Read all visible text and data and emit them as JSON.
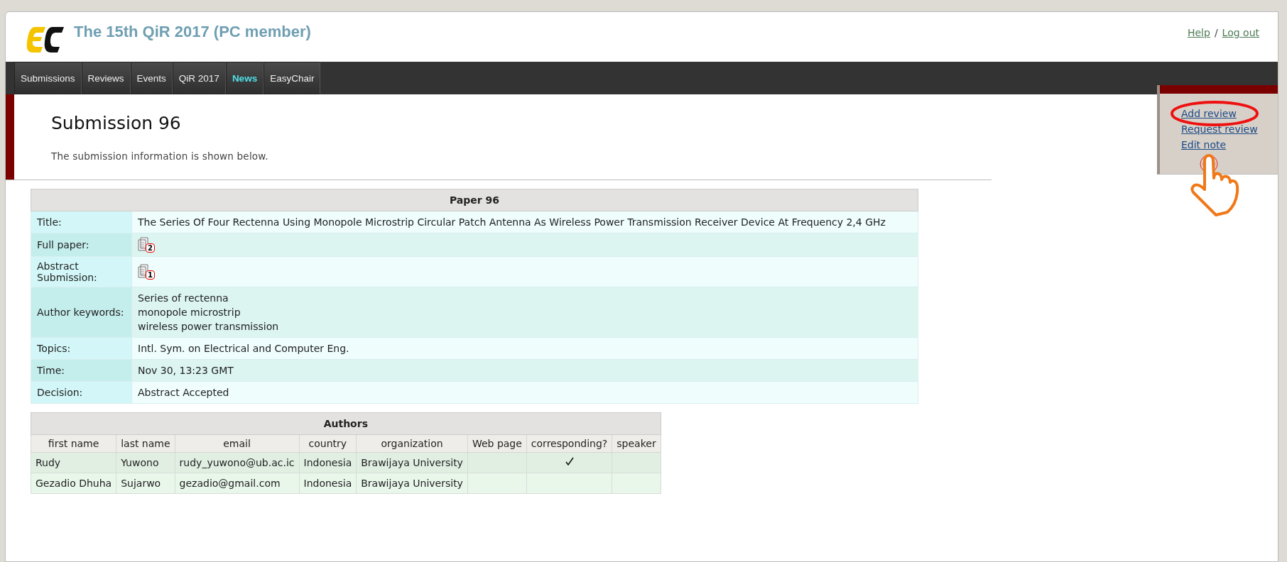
{
  "header": {
    "title": "The 15th QiR 2017 (PC member)",
    "links": [
      "Help",
      "Log out"
    ],
    "separator": "/"
  },
  "nav": [
    {
      "label": "Submissions",
      "highlighted": false
    },
    {
      "label": "Reviews",
      "highlighted": false
    },
    {
      "label": "Events",
      "highlighted": false
    },
    {
      "label": "QiR 2017",
      "highlighted": false
    },
    {
      "label": "News",
      "highlighted": true
    },
    {
      "label": "EasyChair",
      "highlighted": false
    }
  ],
  "page": {
    "heading": "Submission 96",
    "intro": "The submission information is shown below."
  },
  "side_menu": [
    "Add review",
    "Request review",
    "Edit note"
  ],
  "paper_table": {
    "caption": "Paper 96",
    "rows": [
      {
        "kind": "text",
        "label": "Title:",
        "value": "The Series Of Four Rectenna Using Monopole Microstrip Circular Patch Antenna As Wireless Power Transmission Receiver Device At Frequency 2,4 GHz"
      },
      {
        "kind": "file",
        "label": "Full paper:",
        "badge": "2"
      },
      {
        "kind": "file",
        "label": "Abstract Submission:",
        "badge": "1"
      },
      {
        "kind": "lines",
        "label": "Author keywords:",
        "lines": [
          "Series of rectenna",
          "monopole microstrip",
          "wireless power transmission"
        ]
      },
      {
        "kind": "text",
        "label": "Topics:",
        "value": "Intl. Sym. on Electrical and Computer Eng."
      },
      {
        "kind": "text",
        "label": "Time:",
        "value": "Nov 30, 13:23 GMT"
      },
      {
        "kind": "text",
        "label": "Decision:",
        "value": "Abstract Accepted"
      }
    ]
  },
  "authors_table": {
    "caption": "Authors",
    "columns": [
      "first name",
      "last name",
      "email",
      "country",
      "organization",
      "Web page",
      "corresponding?",
      "speaker"
    ],
    "rows": [
      {
        "first_name": "Rudy",
        "last_name": "Yuwono",
        "email": "rudy_yuwono@ub.ac.ic",
        "country": "Indonesia",
        "organization": "Brawijaya University",
        "corresponding": true
      },
      {
        "first_name": "Gezadio Dhuha",
        "last_name": "Sujarwo",
        "email": "gezadio@gmail.com",
        "country": "Indonesia",
        "organization": "Brawijaya University",
        "corresponding": false
      }
    ]
  }
}
